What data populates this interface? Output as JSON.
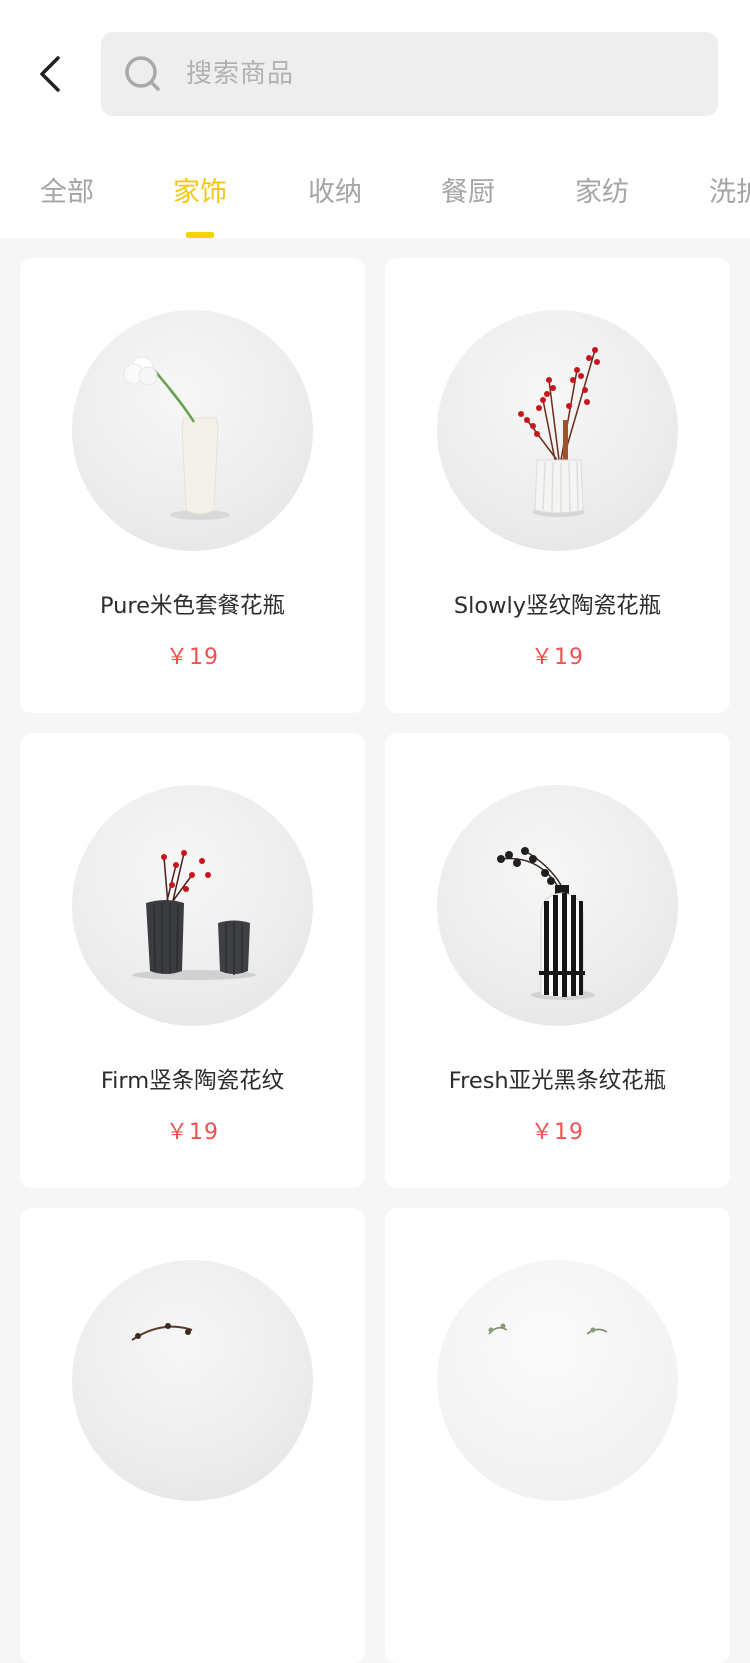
{
  "search": {
    "placeholder": "搜索商品"
  },
  "tabs": [
    "全部",
    "家饰",
    "收纳",
    "餐厨",
    "家纺",
    "洗护"
  ],
  "active_tab_index": 1,
  "colors": {
    "accent": "#f6c710",
    "price": "#f05151"
  },
  "products": [
    {
      "name": "Pure米色套餐花瓶",
      "price": "￥19",
      "image": "white-vase-with-flower"
    },
    {
      "name": "Slowly竖纹陶瓷花瓶",
      "price": "￥19",
      "image": "ribbed-vase-with-red-berries"
    },
    {
      "name": "Firm竖条陶瓷花纹",
      "price": "￥19",
      "image": "black-vases-pair"
    },
    {
      "name": "Fresh亚光黑条纹花瓶",
      "price": "￥19",
      "image": "striped-black-white-vase"
    },
    {
      "name": "",
      "price": "",
      "image": "vase-partial"
    },
    {
      "name": "",
      "price": "",
      "image": "vase-partial"
    }
  ]
}
